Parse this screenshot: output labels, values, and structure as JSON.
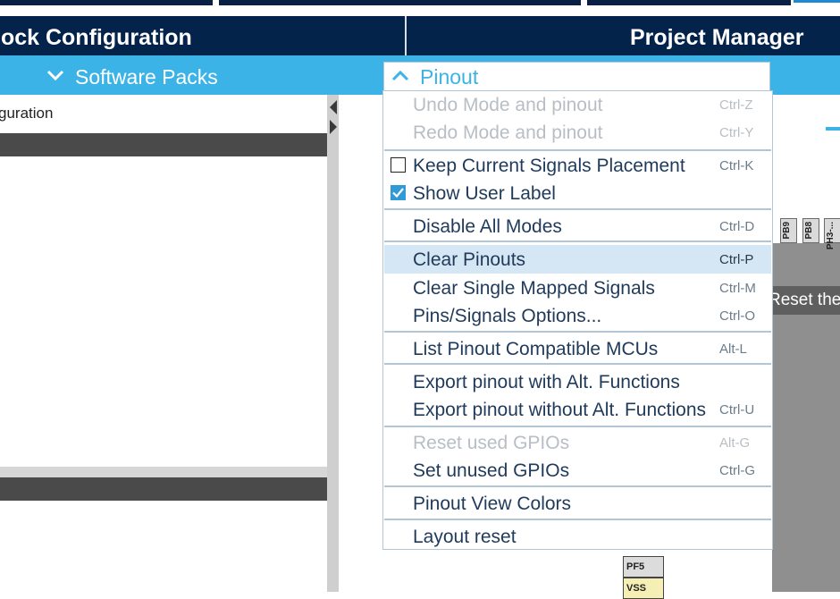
{
  "header": {
    "left_title": "lock Configuration",
    "right_title": "Project Manager"
  },
  "subbar": {
    "software_packs_label": "Software Packs"
  },
  "left_panel": {
    "tree_item": "guration"
  },
  "pinout_menu": {
    "button_label": "Pinout",
    "items": [
      {
        "label": "Undo Mode and pinout",
        "shortcut": "Ctrl-Z",
        "disabled": true
      },
      {
        "label": "Redo Mode and pinout",
        "shortcut": "Ctrl-Y",
        "disabled": true
      },
      {
        "label": "Keep Current Signals Placement",
        "shortcut": "Ctrl-K",
        "checkbox": false
      },
      {
        "label": "Show User Label",
        "shortcut": "",
        "checkbox": true
      },
      {
        "label": "Disable All Modes",
        "shortcut": "Ctrl-D"
      },
      {
        "label": "Clear Pinouts",
        "shortcut": "Ctrl-P",
        "highlighted": true
      },
      {
        "label": "Clear Single Mapped Signals",
        "shortcut": "Ctrl-M"
      },
      {
        "label": "Pins/Signals Options...",
        "shortcut": "Ctrl-O"
      },
      {
        "label": "List Pinout Compatible MCUs",
        "shortcut": "Alt-L"
      },
      {
        "label": "Export pinout with Alt. Functions",
        "shortcut": ""
      },
      {
        "label": "Export pinout without Alt. Functions",
        "shortcut": "Ctrl-U"
      },
      {
        "label": "Reset used GPIOs",
        "shortcut": "Alt-G",
        "disabled": true
      },
      {
        "label": "Set unused GPIOs",
        "shortcut": "Ctrl-G"
      },
      {
        "label": "Pinout View Colors",
        "shortcut": ""
      },
      {
        "label": "Layout reset",
        "shortcut": ""
      }
    ]
  },
  "tooltip": {
    "text": "Reset the"
  },
  "chip": {
    "top_pins": [
      "PB9",
      "PB8",
      "PH3-..."
    ],
    "bottom_pins": [
      "PF5",
      "VSS"
    ]
  },
  "colors": {
    "header_bg": "#03234b",
    "subbar_bg": "#3cb3e6",
    "accent": "#3cb3e6",
    "highlight": "#d5e6f4"
  }
}
